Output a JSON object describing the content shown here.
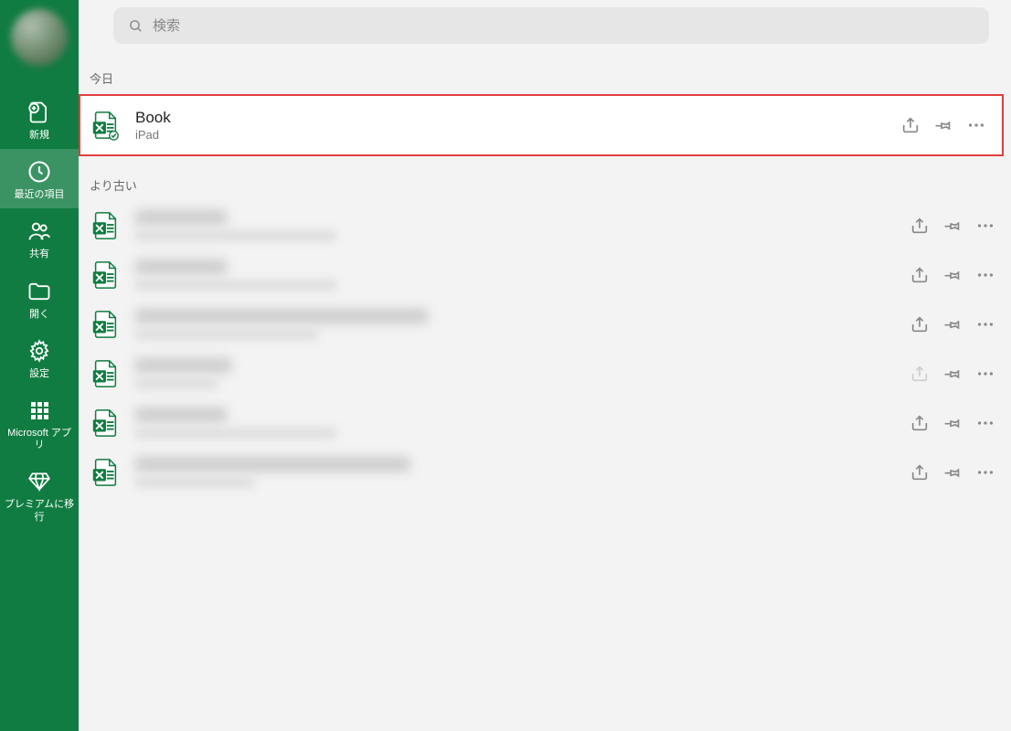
{
  "search": {
    "placeholder": "検索"
  },
  "sidebar": {
    "items": [
      {
        "label": "新規"
      },
      {
        "label": "最近の項目"
      },
      {
        "label": "共有"
      },
      {
        "label": "開く"
      },
      {
        "label": "設定"
      },
      {
        "label": "Microsoft アプリ"
      },
      {
        "label": "プレミアムに移行"
      }
    ]
  },
  "sections": {
    "today": "今日",
    "older": "より古い"
  },
  "docs": {
    "today": [
      {
        "title": "Book",
        "sub": "iPad"
      }
    ],
    "older": [
      {
        "title": "",
        "sub": ""
      },
      {
        "title": "",
        "sub": ""
      },
      {
        "title": "",
        "sub": ""
      },
      {
        "title": "",
        "sub": ""
      },
      {
        "title": "",
        "sub": ""
      },
      {
        "title": "",
        "sub": ""
      }
    ]
  }
}
